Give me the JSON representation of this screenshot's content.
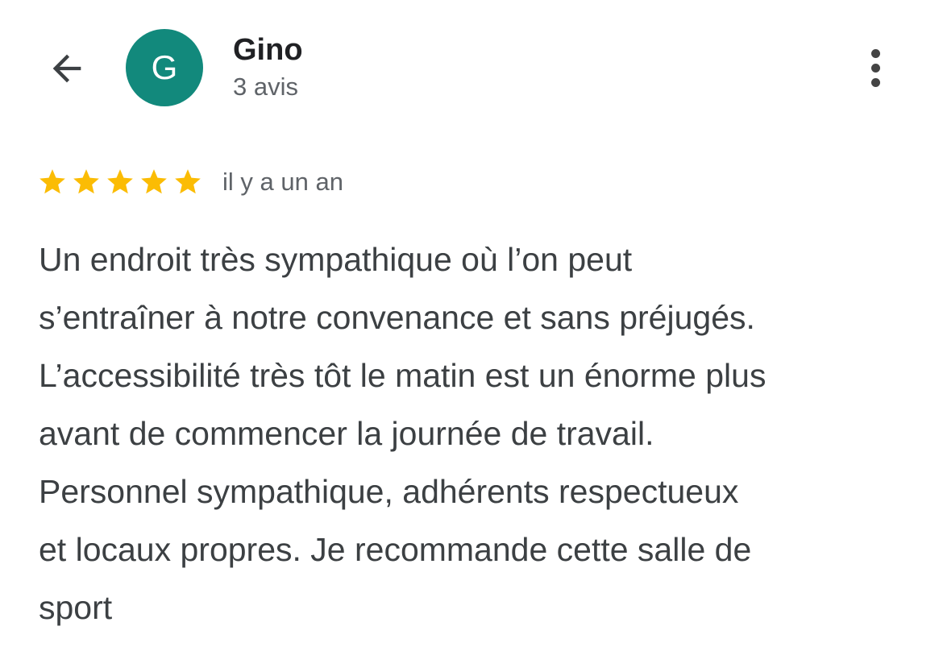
{
  "header": {
    "back_icon": "arrow-left-icon",
    "avatar_letter": "G",
    "avatar_color": "#12897c",
    "user_name": "Gino",
    "review_count": "3 avis",
    "menu_icon": "more-vertical-icon"
  },
  "review": {
    "rating": 5,
    "rating_max": 5,
    "star_color": "#fbbc04",
    "time": "il y a un an",
    "text": "Un endroit très sympathique où l’on peut\ns’entraîner à notre convenance et sans préjugés.\nL’accessibilité très tôt le matin est un énorme plus\navant de commencer la journée de travail.\nPersonnel sympathique, adhérents respectueux\net locaux propres. Je recommande cette salle de\nsport"
  }
}
